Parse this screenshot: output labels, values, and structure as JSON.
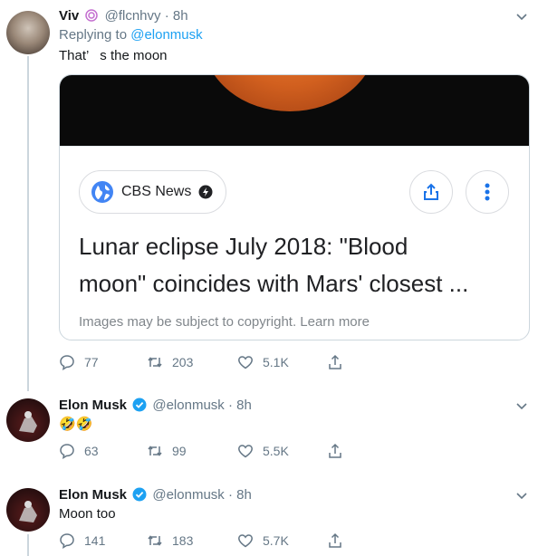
{
  "tweets": [
    {
      "name": "Viv",
      "handle": "@flcnhvy",
      "time": "8h",
      "reply_label": "Replying to",
      "reply_handle": "@elonmusk",
      "text": "That’   s the moon",
      "card": {
        "source": "CBS News",
        "headline_line1": "Lunar eclipse July 2018: \"Blood",
        "headline_line2": "moon\" coincides with Mars' closest ...",
        "note": "Images may be subject to copyright. Learn more"
      },
      "replies": "77",
      "retweets": "203",
      "likes": "5.1K"
    },
    {
      "name": "Elon Musk",
      "handle": "@elonmusk",
      "time": "8h",
      "text": "🤣🤣",
      "replies": "63",
      "retweets": "99",
      "likes": "5.5K"
    },
    {
      "name": "Elon Musk",
      "handle": "@elonmusk",
      "time": "8h",
      "text": "Moon too",
      "replies": "141",
      "retweets": "183",
      "likes": "5.7K"
    }
  ],
  "colors": {
    "link": "#1da1f2",
    "secondary_text": "#657786",
    "verified": "#1da1f2",
    "card_button_icon": "#1a73e8"
  },
  "icons": [
    "chevron-down-icon",
    "verified-icon",
    "globe-icon",
    "amp-bolt-icon",
    "share-icon",
    "more-vertical-icon",
    "reply-icon",
    "retweet-icon",
    "like-icon",
    "share-tweet-icon"
  ]
}
